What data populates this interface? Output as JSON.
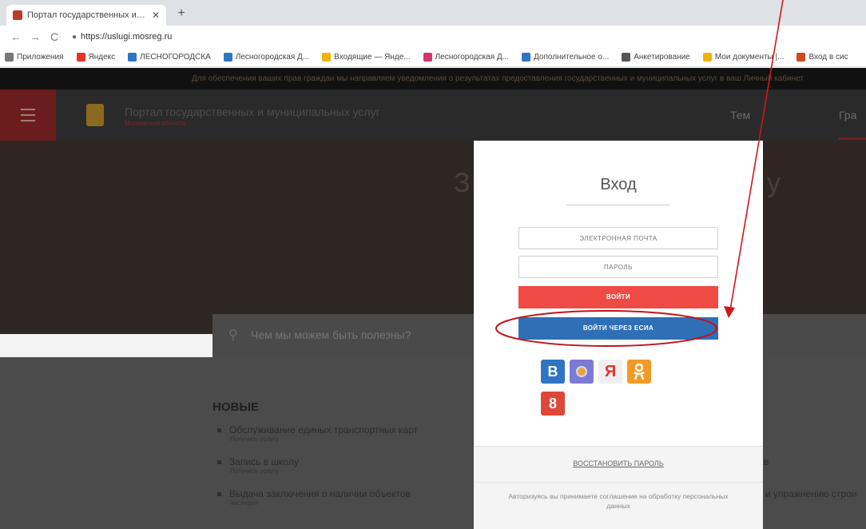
{
  "browser": {
    "tab_title": "Портал государственных и муни",
    "tab_close": "✕",
    "new_tab": "+",
    "url": "https://uslugi.mosreg.ru",
    "back": "←",
    "forward": "→",
    "reload": "C",
    "lock": "●",
    "bookmarks": [
      {
        "label": "Приложения",
        "color": "#777777"
      },
      {
        "label": "Яндекс",
        "color": "#e8332b"
      },
      {
        "label": "ЛЕСНОГОРОДСКА",
        "color": "#2f75c3"
      },
      {
        "label": "Лесногородская Д...",
        "color": "#2f75c3"
      },
      {
        "label": "Входящие — Янде...",
        "color": "#f0b400"
      },
      {
        "label": "Лесногородская Д...",
        "color": "#d5336b"
      },
      {
        "label": "Дополнительное о...",
        "color": "#2f75c3"
      },
      {
        "label": "Анкетирование",
        "color": "#555555"
      },
      {
        "label": "Мои документы |...",
        "color": "#f0b400"
      },
      {
        "label": "Вход в сис",
        "color": "#d04a1f"
      }
    ]
  },
  "page": {
    "notice": "Для обеспечения ваших прав граждан мы направляем уведомления о результатах предоставления государственных и муниципальных услуг в ваш Личный кабинет",
    "site_title": "Портал государственных и муниципальных услуг",
    "site_sub": "Московской области",
    "nav_1": "Тем",
    "nav_2": "Гра",
    "hero_left": "З",
    "hero_right": "у",
    "search_placeholder": "Чем мы можем быть полезны?",
    "section_title": "НОВЫЕ",
    "services": [
      {
        "title": "Обслуживание единых транспортных карт",
        "sub": "Получить услугу"
      },
      {
        "title": "Запись в школу",
        "sub": "Получить услугу"
      },
      {
        "title": "Выдача заключения о наличии объектов",
        "sub": "наследия"
      }
    ],
    "right_fragments": [
      "в",
      "и упражнению строи"
    ]
  },
  "modal": {
    "title": "Вход",
    "email_placeholder": "ЭЛЕКТРОННАЯ ПОЧТА",
    "password_placeholder": "ПАРОЛЬ",
    "login_label": "ВОЙТИ",
    "esia_label": "ВОЙТИ ЧЕРЕЗ ЕСИА",
    "social": {
      "vk": "B",
      "ya": "Я",
      "ok": "ok",
      "gp": "8"
    },
    "restore_label": "ВОССТАНОВИТЬ ПАРОЛЬ",
    "agreement": "Авторизуясь вы принимаете соглашение на обработку персональных данных"
  }
}
